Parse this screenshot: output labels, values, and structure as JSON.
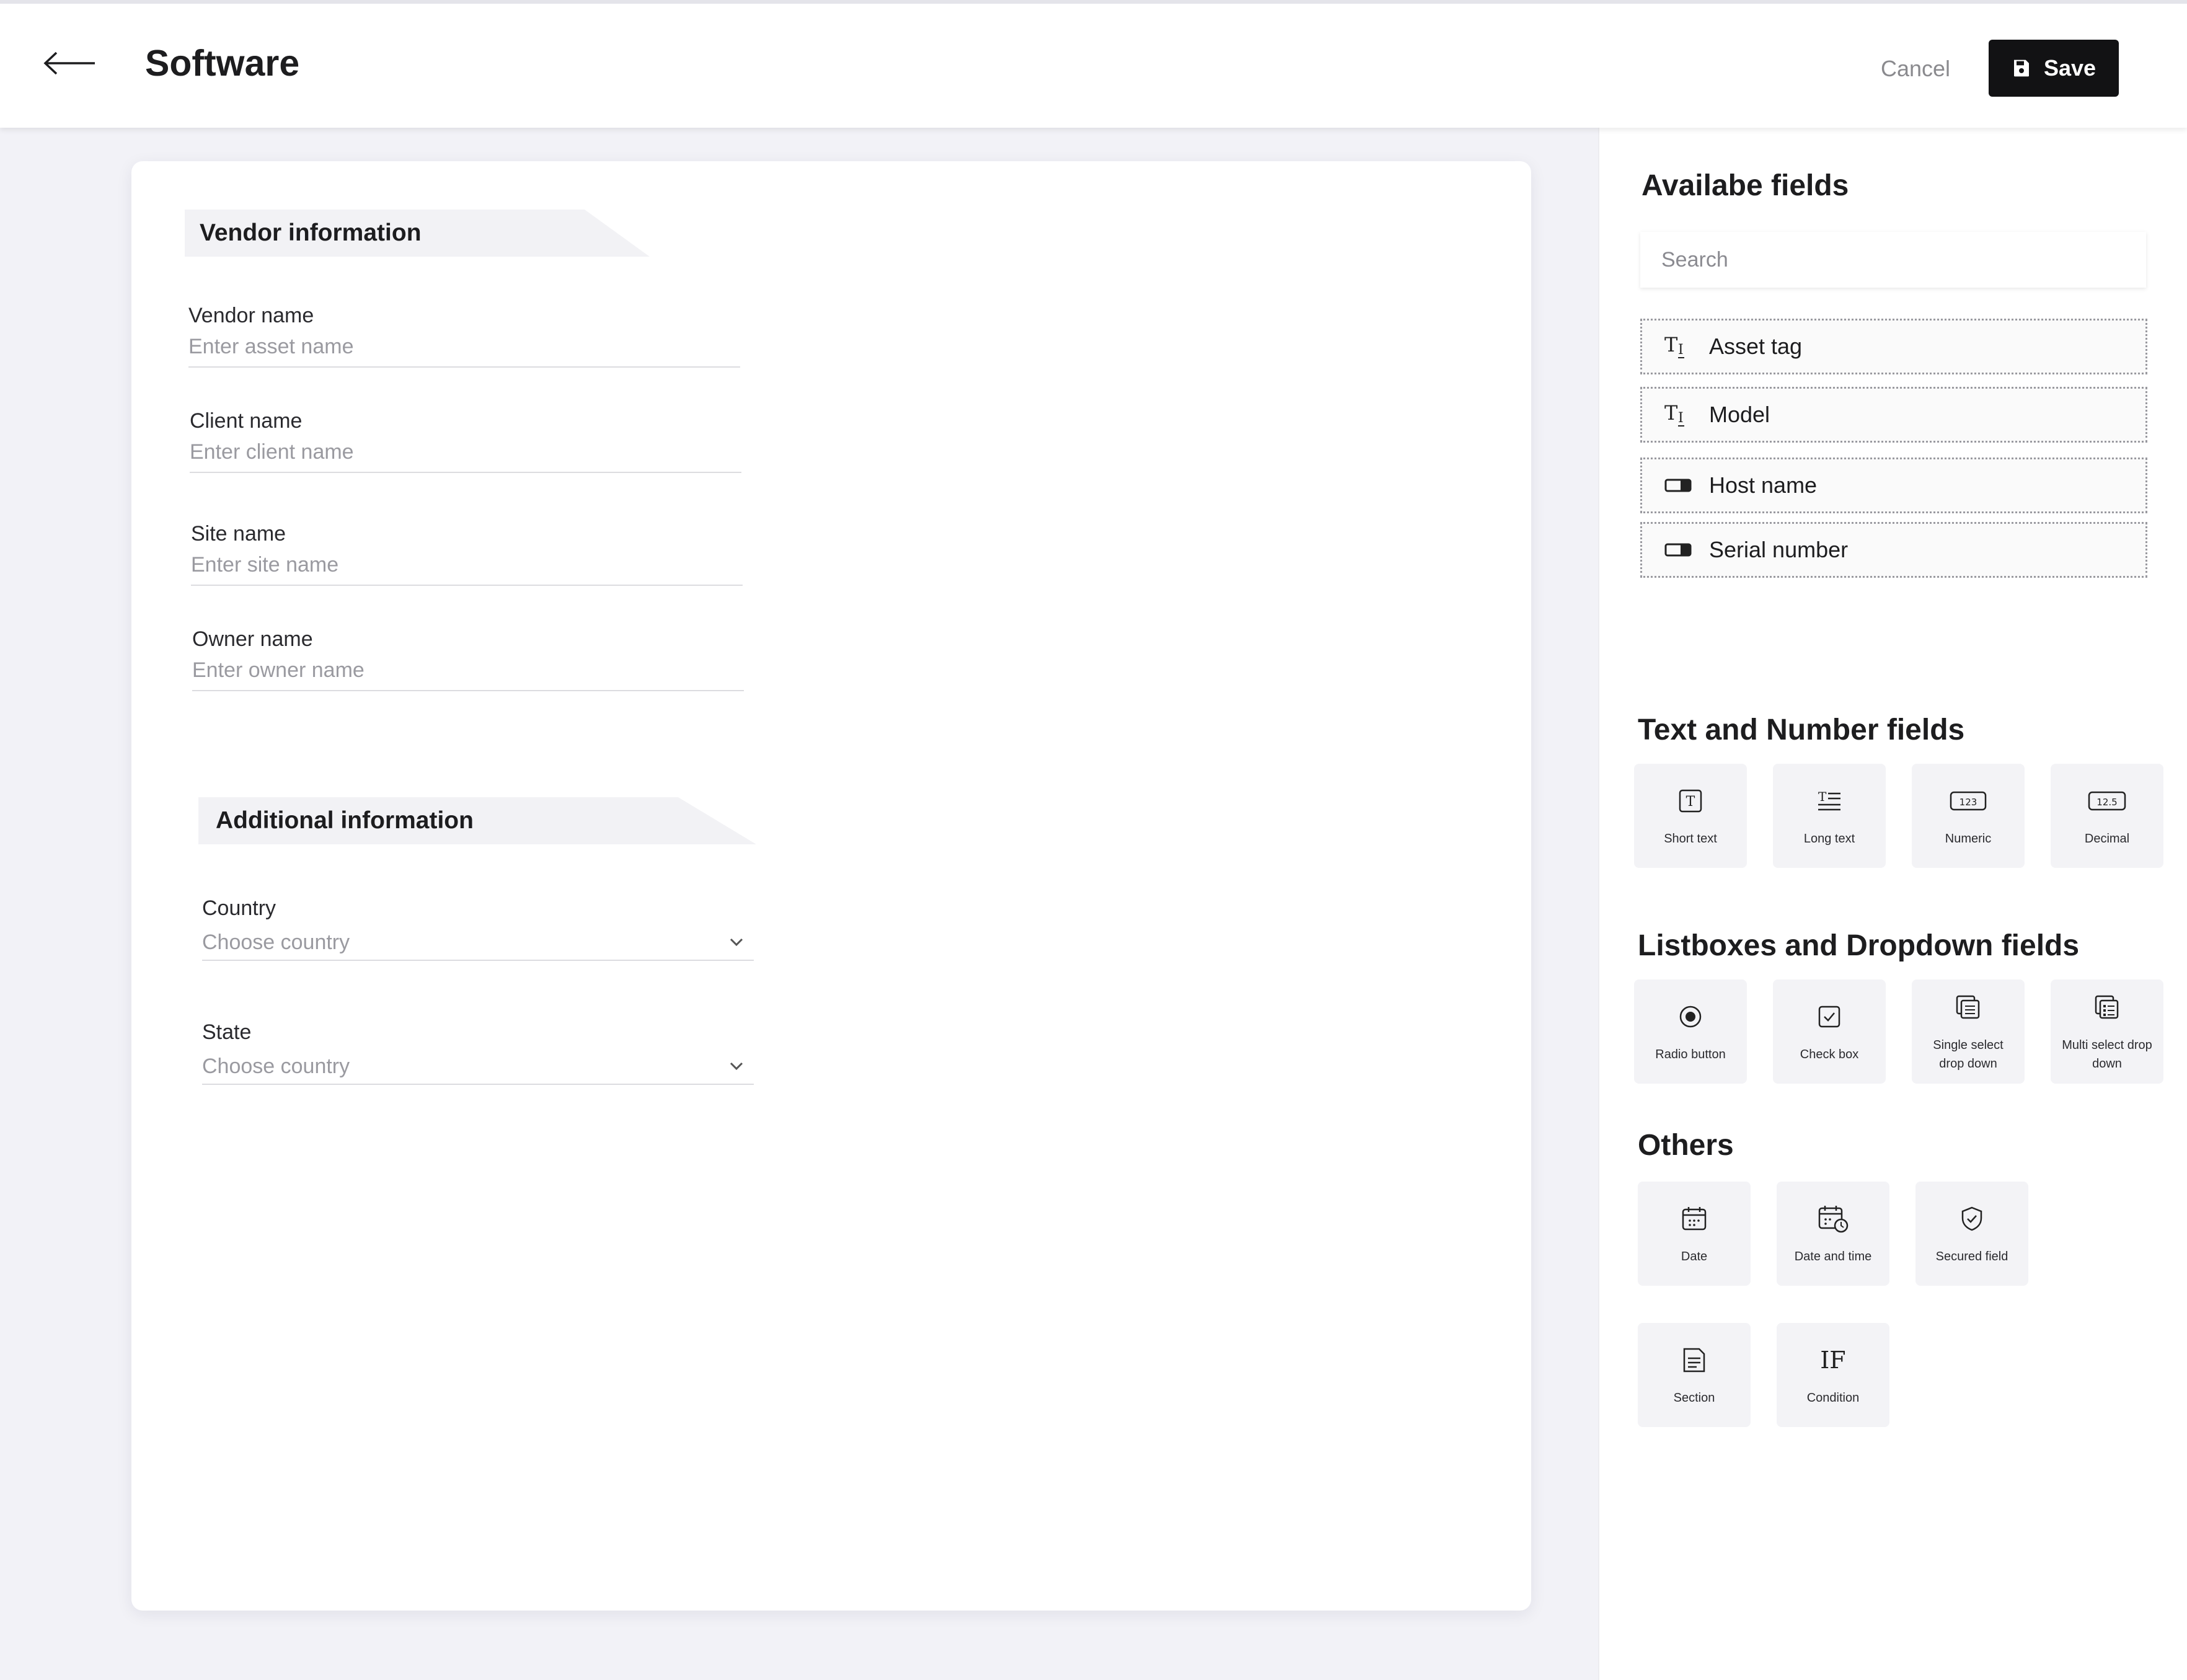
{
  "header": {
    "title": "Software",
    "cancel_label": "Cancel",
    "save_label": "Save"
  },
  "form": {
    "vendor_section": {
      "title": "Vendor information",
      "fields": [
        {
          "label": "Vendor name",
          "placeholder": "Enter asset name"
        },
        {
          "label": "Client name",
          "placeholder": "Enter client name"
        },
        {
          "label": "Site name",
          "placeholder": "Enter site name"
        },
        {
          "label": "Owner name",
          "placeholder": "Enter owner name"
        }
      ]
    },
    "additional_section": {
      "title": "Additional information",
      "fields": [
        {
          "label": "Country",
          "placeholder": "Choose country"
        },
        {
          "label": "State",
          "placeholder": "Choose country"
        }
      ]
    }
  },
  "panel": {
    "available_title": "Availabe fields",
    "search_placeholder": "Search",
    "available_fields": [
      {
        "label": "Asset tag",
        "icon": "text-type-icon"
      },
      {
        "label": "Model",
        "icon": "text-type-icon"
      },
      {
        "label": "Host name",
        "icon": "toggle-input-icon"
      },
      {
        "label": "Serial number",
        "icon": "toggle-input-icon"
      }
    ],
    "text_number_title": "Text and Number fields",
    "text_number_tiles": [
      {
        "label": "Short text",
        "icon": "short-text-icon"
      },
      {
        "label": "Long text",
        "icon": "long-text-icon"
      },
      {
        "label": "Numeric",
        "icon": "numeric-icon",
        "glyph": "123"
      },
      {
        "label": "Decimal",
        "icon": "decimal-icon",
        "glyph": "12.5"
      }
    ],
    "listbox_title": "Listboxes and Dropdown fields",
    "listbox_tiles": [
      {
        "label": "Radio button",
        "icon": "radio-icon"
      },
      {
        "label": "Check box",
        "icon": "checkbox-icon"
      },
      {
        "label": "Single select drop down",
        "icon": "single-select-icon"
      },
      {
        "label": "Multi select drop down",
        "icon": "multi-select-icon"
      }
    ],
    "others_title": "Others",
    "others_tiles": [
      {
        "label": "Date",
        "icon": "calendar-icon"
      },
      {
        "label": "Date and time",
        "icon": "calendar-clock-icon"
      },
      {
        "label": "Secured field",
        "icon": "shield-icon"
      },
      {
        "label": "Section",
        "icon": "section-icon"
      },
      {
        "label": "Condition",
        "icon": "condition-icon",
        "glyph": "IF"
      }
    ]
  }
}
